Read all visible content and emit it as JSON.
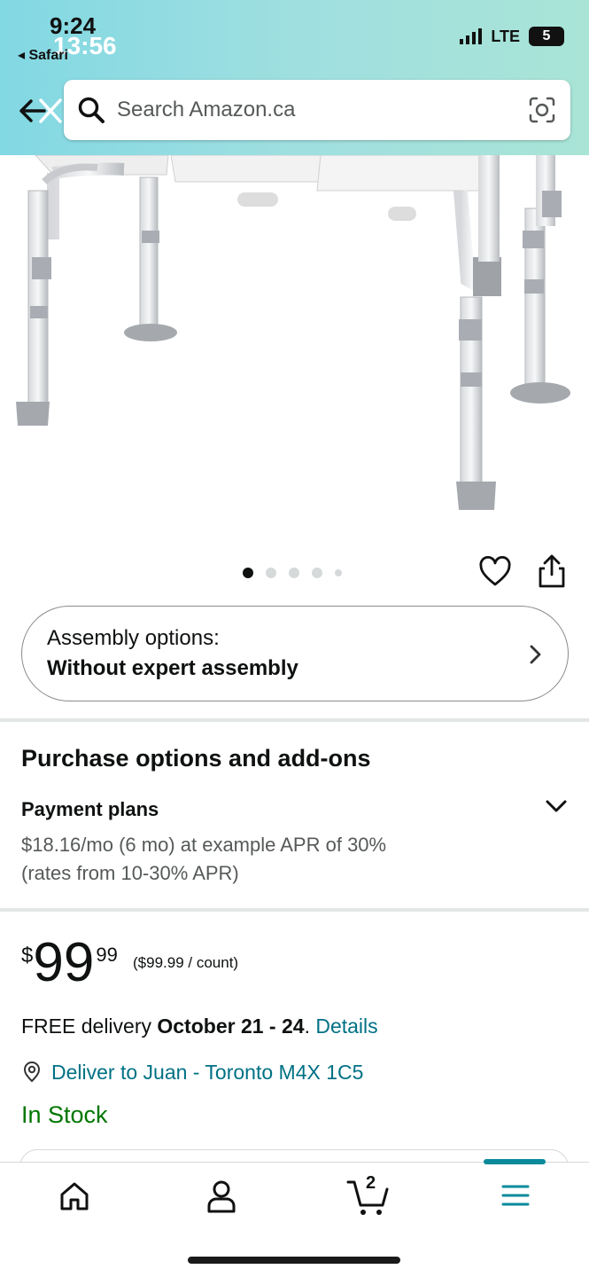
{
  "status_bar": {
    "time": "9:24",
    "time_overlay": "13:56",
    "back_app": "◂ Safari",
    "network": "LTE",
    "battery": "5"
  },
  "search": {
    "placeholder": "Search Amazon.ca"
  },
  "gallery": {
    "dot_count": 5,
    "active_dot": 0
  },
  "assembly": {
    "label": "Assembly options:",
    "value": "Without expert assembly"
  },
  "purchase_options": {
    "title": "Purchase options and add-ons",
    "payment_plans_title": "Payment plans",
    "line1": "$18.16/mo (6 mo) at example APR of 30%",
    "line2": "(rates from 10-30% APR)"
  },
  "price": {
    "symbol": "$",
    "whole": "99",
    "fraction": "99",
    "unit_price": "($99.99 / count)"
  },
  "delivery": {
    "prefix": "FREE delivery ",
    "dates": "October 21 - 24",
    "suffix": ". ",
    "details_link": "Details"
  },
  "deliver_to": "Deliver to Juan - Toronto M4X 1C5",
  "stock_status": "In Stock",
  "bottom_nav": {
    "cart_count": "2"
  },
  "colors": {
    "link": "#007185",
    "in_stock": "#007600",
    "accent": "#0a8a9b"
  }
}
